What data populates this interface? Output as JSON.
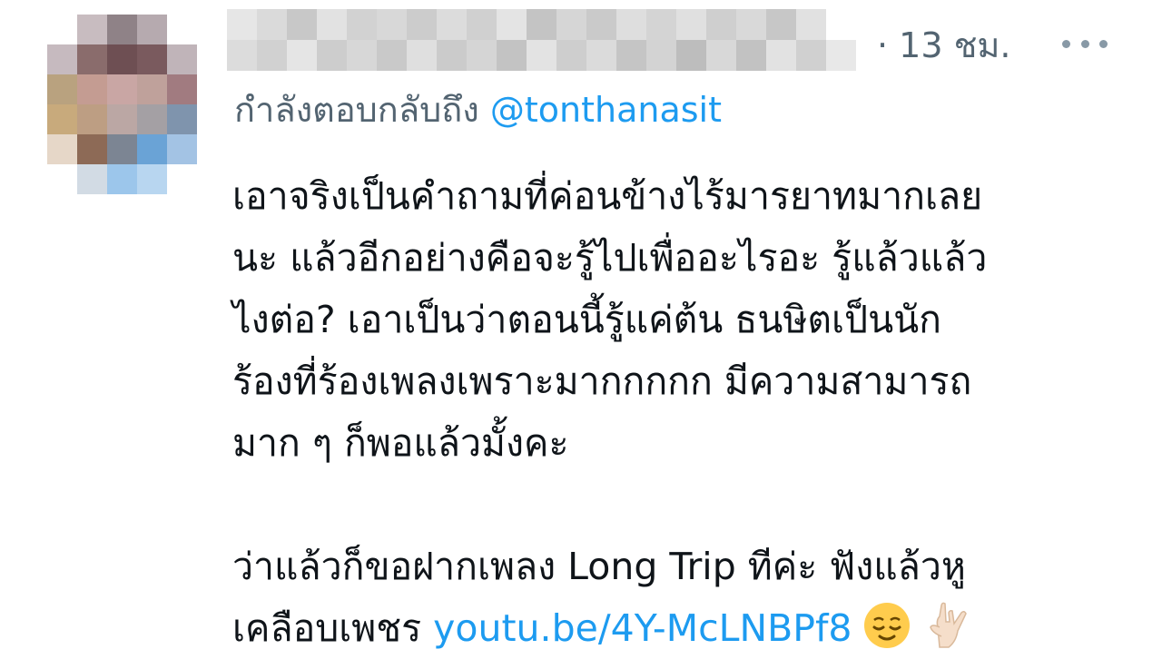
{
  "avatar": {
    "icon": "pixelated-avatar-icon",
    "pixels": [
      [
        "#ffffff",
        "#c8bcc0",
        "#8f8287",
        "#b6aaaf",
        "#ffffff"
      ],
      [
        "#c6babf",
        "#8a6c6c",
        "#6e4f53",
        "#7a5a5e",
        "#c0b4b9"
      ],
      [
        "#b9a27f",
        "#c49c92",
        "#c9a6a4",
        "#bfa19b",
        "#a17b80"
      ],
      [
        "#c8aa7c",
        "#bd9e83",
        "#bba7a4",
        "#a4a0a4",
        "#7f94ad"
      ],
      [
        "#e6d7c8",
        "#8d6a56",
        "#7c8593",
        "#6aa3d6",
        "#a3c3e4"
      ],
      [
        "#ffffff",
        "#d2dbe4",
        "#9cc6eb",
        "#b8d6f0",
        "#ffffff"
      ]
    ]
  },
  "header": {
    "name_blur_colors": [
      [
        "#e6e6e6",
        "#dadada",
        "#c8c8c8",
        "#e2e2e2",
        "#d2d2d2",
        "#d8d8d8",
        "#cccccc",
        "#dcdcdc",
        "#d0d0d0",
        "#e4e4e4",
        "#c4c4c4",
        "#d6d6d6",
        "#cacaca",
        "#dedede",
        "#d4d4d4",
        "#e0e0e0",
        "#cfcfcf",
        "#d9d9d9",
        "#c7c7c7",
        "#e1e1e1",
        "#ffffff"
      ],
      [
        "#dcdcdc",
        "#d1d1d1",
        "#e5e5e5",
        "#cdcdcd",
        "#d7d7d7",
        "#c9c9c9",
        "#dfdfdf",
        "#cbcbcb",
        "#d5d5d5",
        "#c3c3c3",
        "#e3e3e3",
        "#cecece",
        "#dbdbdb",
        "#c5c5c5",
        "#d3d3d3",
        "#bdbdbd",
        "#d8d8d8",
        "#c2c2c2",
        "#e2e2e2",
        "#d0d0d0",
        "#e8e8e8"
      ]
    ],
    "time": "· 13 ชม.",
    "more_icon": "more-horizontal-icon"
  },
  "reply": {
    "prefix": "กำลังตอบกลับถึง ",
    "mention": "@tonthanasit"
  },
  "tweet": {
    "lines": [
      "เอาจริงเป็นคำถามที่ค่อนข้างไร้มารยาทมากเลย",
      "นะ แล้วอีกอย่างคือจะรู้ไปเพื่ออะไรอะ รู้แล้วแล้ว",
      "ไงต่อ? เอาเป็นว่าตอนนี้รู้แค่ต้น ธนษิตเป็นนัก",
      "ร้องที่ร้องเพลงเพราะมากกกกก มีความสามารถ",
      "มาก ๆ ก็พอแล้วมั้งคะ"
    ],
    "line6": "ว่าแล้วก็ขอฝากเพลง Long Trip ทีค่ะ ฟังแล้วหู",
    "line7_text": "เคลือบเพชร ",
    "link": "youtu.be/4Y-McLNBPf8",
    "emoji1": "relieved-face-icon",
    "emoji2": "love-you-gesture-icon"
  }
}
